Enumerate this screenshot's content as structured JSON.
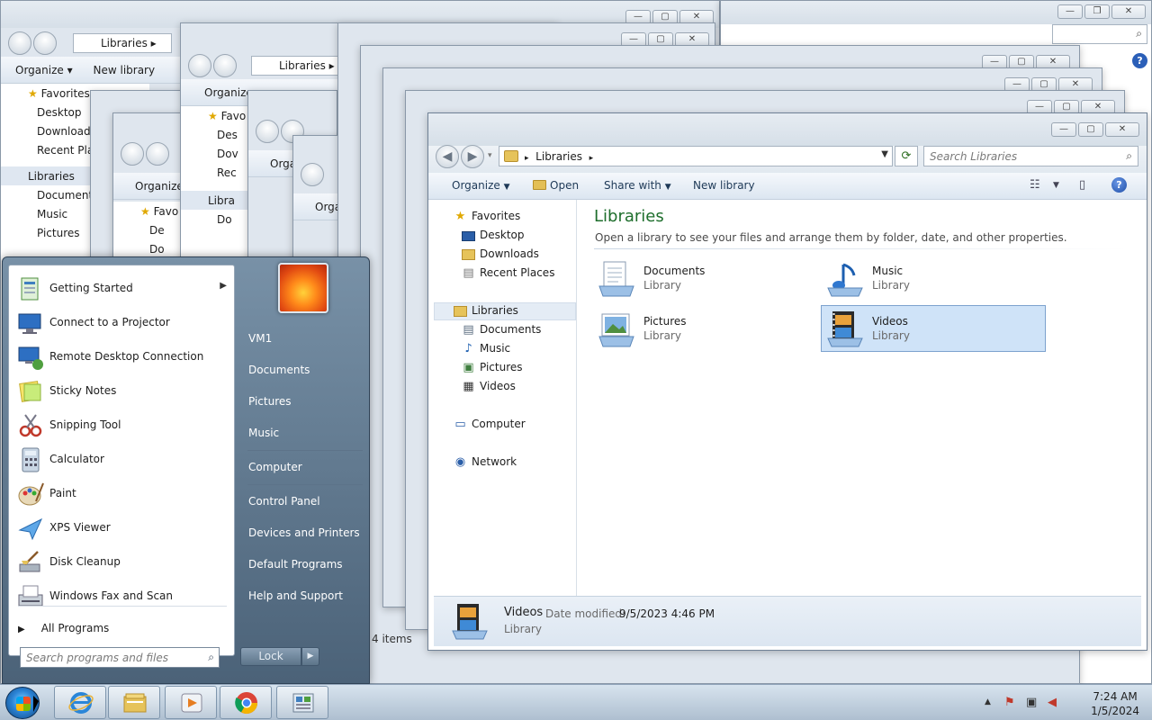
{
  "bg_windows": {
    "title": "Libraries",
    "organize": "Organize",
    "new_library": "New library",
    "favorites": "Favorites",
    "favorites_short": "Favo",
    "desktop": "Desktop",
    "downloads": "Downloads",
    "recent": "Recent Places",
    "libraries": "Libraries",
    "documents": "Documents",
    "music": "Music",
    "pictures": "Pictures",
    "items_count": "4 items"
  },
  "explorer": {
    "breadcrumb": "Libraries",
    "search_placeholder": "Search Libraries",
    "toolbar": {
      "organize": "Organize",
      "open": "Open",
      "share_with": "Share with",
      "new_library": "New library"
    },
    "nav": {
      "favorites": "Favorites",
      "desktop": "Desktop",
      "downloads": "Downloads",
      "recent_places": "Recent Places",
      "libraries": "Libraries",
      "documents": "Documents",
      "music": "Music",
      "pictures": "Pictures",
      "videos": "Videos",
      "computer": "Computer",
      "network": "Network"
    },
    "content": {
      "title": "Libraries",
      "description": "Open a library to see your files and arrange them by folder, date, and other properties.",
      "items": [
        {
          "name": "Documents",
          "type": "Library"
        },
        {
          "name": "Music",
          "type": "Library"
        },
        {
          "name": "Pictures",
          "type": "Library"
        },
        {
          "name": "Videos",
          "type": "Library"
        }
      ]
    },
    "details": {
      "name": "Videos",
      "date_label": "Date modified:",
      "date_value": "9/5/2023 4:46 PM",
      "type": "Library"
    }
  },
  "start_menu": {
    "programs": [
      {
        "label": "Getting Started",
        "has_submenu": true
      },
      {
        "label": "Connect to a Projector"
      },
      {
        "label": "Remote Desktop Connection"
      },
      {
        "label": "Sticky Notes"
      },
      {
        "label": "Snipping Tool"
      },
      {
        "label": "Calculator"
      },
      {
        "label": "Paint"
      },
      {
        "label": "XPS Viewer"
      },
      {
        "label": "Disk Cleanup"
      },
      {
        "label": "Windows Fax and Scan"
      }
    ],
    "all_programs": "All Programs",
    "search_placeholder": "Search programs and files",
    "right": {
      "user": "VM1",
      "documents": "Documents",
      "pictures": "Pictures",
      "music": "Music",
      "computer": "Computer",
      "control_panel": "Control Panel",
      "devices_printers": "Devices and Printers",
      "default_programs": "Default Programs",
      "help_support": "Help and Support"
    },
    "lock": "Lock"
  },
  "taskbar": {
    "time": "7:24 AM",
    "date": "1/5/2024"
  }
}
